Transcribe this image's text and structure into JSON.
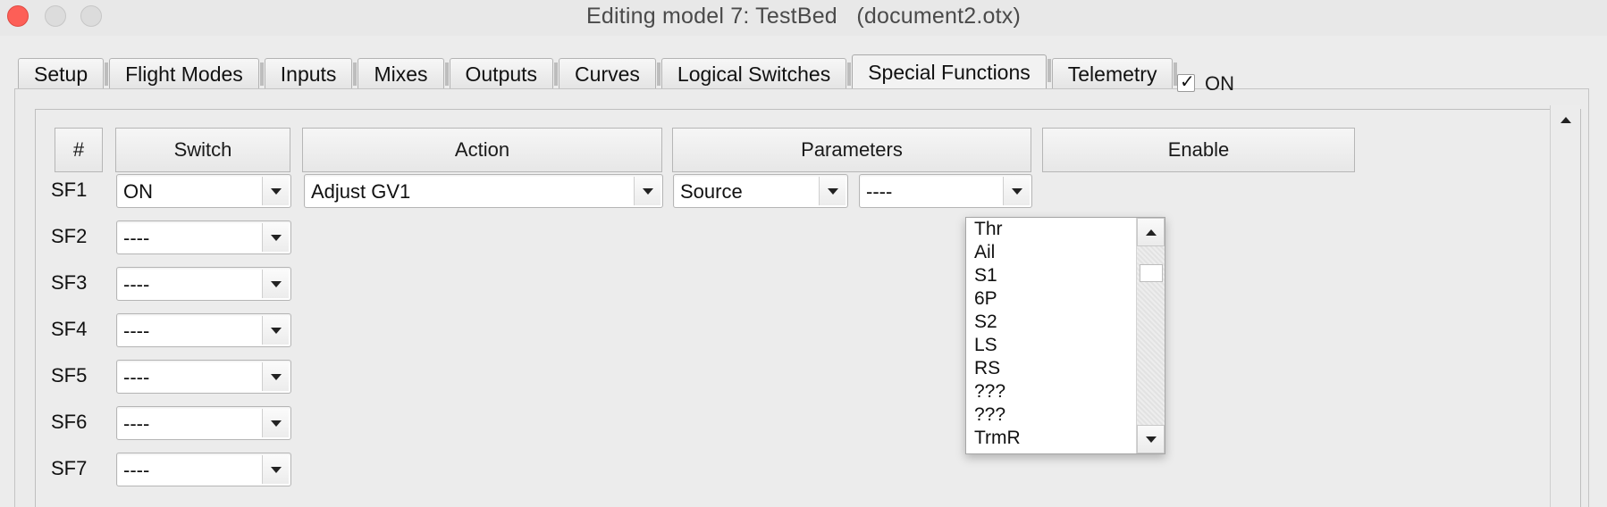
{
  "window": {
    "title": "Editing model 7: TestBed   (document2.otx)"
  },
  "tabs": [
    {
      "label": "Setup"
    },
    {
      "label": "Flight Modes"
    },
    {
      "label": "Inputs"
    },
    {
      "label": "Mixes"
    },
    {
      "label": "Outputs"
    },
    {
      "label": "Curves"
    },
    {
      "label": "Logical Switches"
    },
    {
      "label": "Special Functions"
    },
    {
      "label": "Telemetry"
    }
  ],
  "active_tab": "Special Functions",
  "columns": {
    "index": "#",
    "switch": "Switch",
    "action": "Action",
    "parameters": "Parameters",
    "enable": "Enable"
  },
  "rows": [
    {
      "label": "SF1",
      "switch": "ON",
      "action": "Adjust GV1",
      "param_mode": "Source",
      "param_value": "----",
      "enabled": true,
      "enable_label": "ON"
    },
    {
      "label": "SF2",
      "switch": "----"
    },
    {
      "label": "SF3",
      "switch": "----"
    },
    {
      "label": "SF4",
      "switch": "----"
    },
    {
      "label": "SF5",
      "switch": "----"
    },
    {
      "label": "SF6",
      "switch": "----"
    },
    {
      "label": "SF7",
      "switch": "----"
    }
  ],
  "dropdown": {
    "items": [
      "Thr",
      "Ail",
      "S1",
      "6P",
      "S2",
      "LS",
      "RS",
      "???",
      "???",
      "TrmR"
    ]
  },
  "icons": {
    "close": "close-icon",
    "minimize": "minimize-icon",
    "maximize": "maximize-icon",
    "dropdown_arrow": "chevron-down-icon",
    "scroll_up": "scroll-up-icon",
    "scroll_down": "scroll-down-icon",
    "check": "check-icon"
  },
  "colors": {
    "close_button": "#fd5f57",
    "window_bg": "#ececec"
  }
}
